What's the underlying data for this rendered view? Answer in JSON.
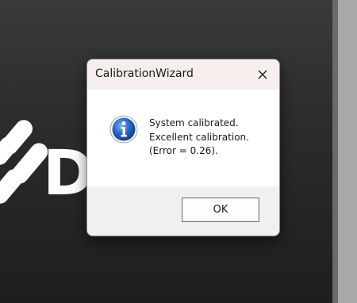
{
  "background": {
    "logo_letter": "D"
  },
  "dialog": {
    "title": "CalibrationWizard",
    "close_icon": "close-icon",
    "icon": "information-icon",
    "message_lines": [
      "System calibrated.",
      "Excellent calibration.",
      "(Error = 0.26)."
    ],
    "ok_label": "OK"
  },
  "colors": {
    "titlebar": "#f5eeec",
    "footer": "#f0f0f0",
    "icon_blue": "#1f5fbf"
  }
}
